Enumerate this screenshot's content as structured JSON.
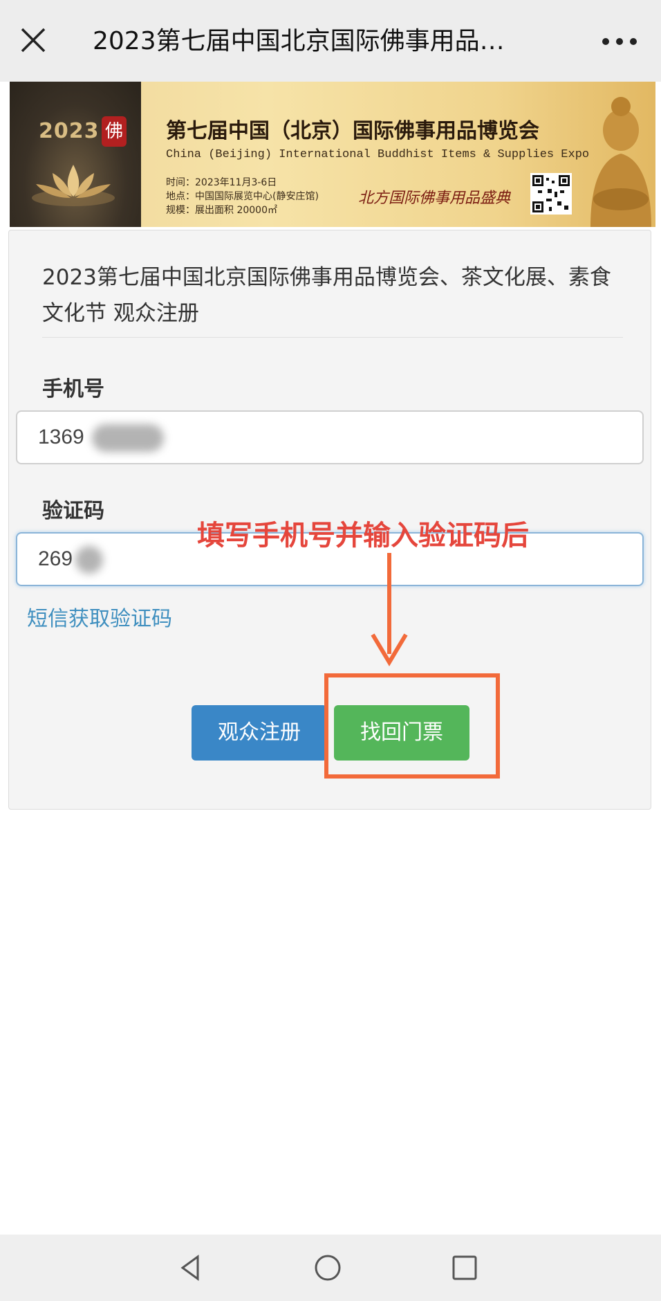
{
  "topbar": {
    "title": "2023第七届中国北京国际佛事用品…",
    "close_icon": "close-icon",
    "more_icon": "more-icon"
  },
  "banner": {
    "year": "2023",
    "seal": "佛",
    "title": "第七届中国（北京）国际佛事用品博览会",
    "subtitle_en": "China (Beijing) International Buddhist Items & Supplies Expo",
    "time": "时间：2023年11月3-6日",
    "location": "地点：中国国际展览中心(静安庄馆)",
    "scale": "规模：展出面积 20000㎡",
    "signature": "北方国际佛事用品盛典"
  },
  "form": {
    "title": "2023第七届中国北京国际佛事用品博览会、茶文化展、素食文化节 观众注册",
    "phone_label": "手机号",
    "phone_value": "1369",
    "code_label": "验证码",
    "code_value": "269",
    "sms_link": "短信获取验证码",
    "register_button": "观众注册",
    "retrieve_button": "找回门票"
  },
  "annotation": {
    "text": "填写手机号并输入验证码后",
    "color": "#e5463c",
    "box_color": "#f26a3a"
  },
  "colors": {
    "register_button": "#3a87c7",
    "retrieve_button": "#54b65a",
    "link": "#3f8fbf"
  },
  "navbar": {
    "back_icon": "back-triangle-icon",
    "home_icon": "home-circle-icon",
    "recents_icon": "recents-square-icon"
  }
}
